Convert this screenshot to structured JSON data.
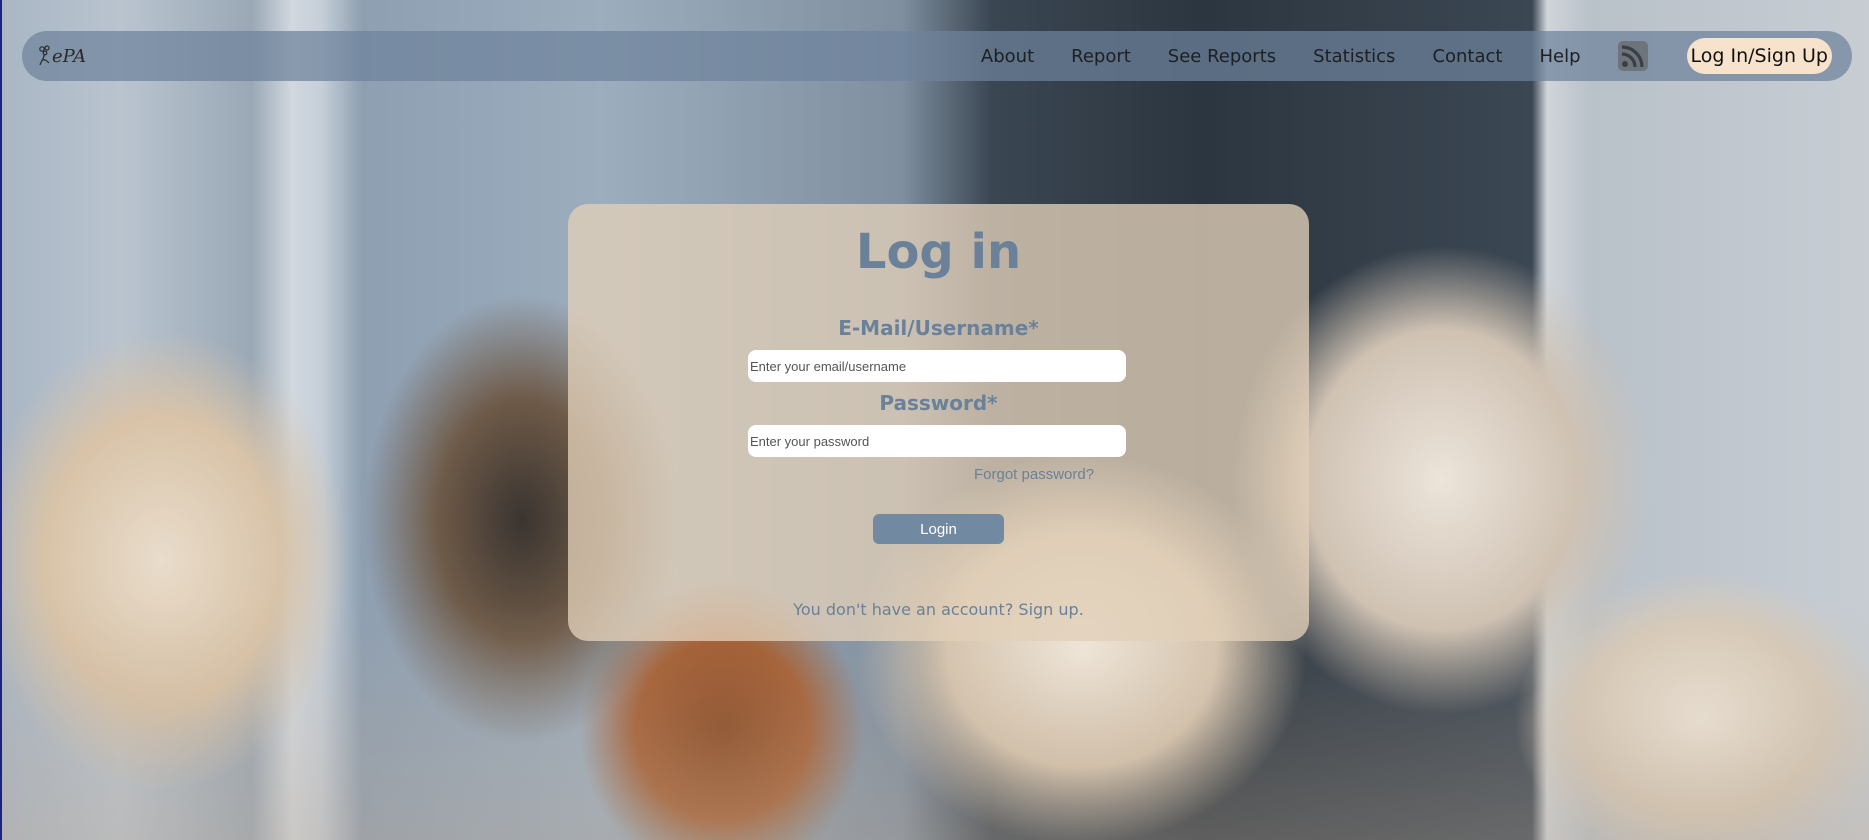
{
  "nav": {
    "logo_text": "ePA",
    "links": [
      "About",
      "Report",
      "See Reports",
      "Statistics",
      "Contact",
      "Help"
    ],
    "rss_icon": "rss-feed-icon",
    "login_signup": "Log In/Sign Up"
  },
  "login": {
    "title": "Log in",
    "email_label": "E-Mail/Username*",
    "email_placeholder": "Enter your email/username",
    "password_label": "Password*",
    "password_placeholder": "Enter your password",
    "forgot_password": "Forgot password?",
    "login_button": "Login",
    "signup_prompt": "You don't have an account?",
    "signup_link": "Sign up."
  },
  "colors": {
    "accent": "#6a8199",
    "button": "#728aa1",
    "nav_pill": "#f7e2cc"
  }
}
